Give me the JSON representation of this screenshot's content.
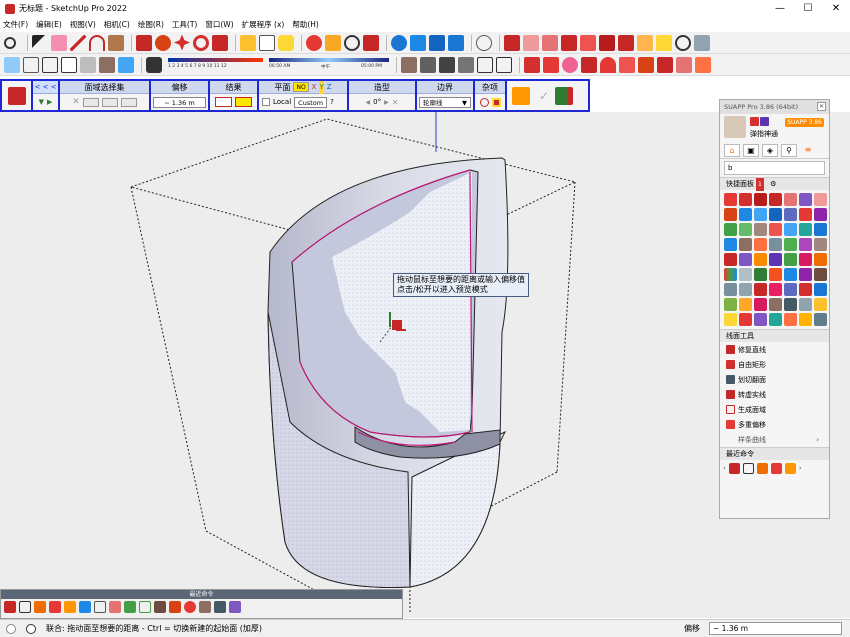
{
  "window": {
    "title": "无标题 - SketchUp Pro 2022",
    "min": "—",
    "max": "☐",
    "close": "✕"
  },
  "menu": [
    "文件(F)",
    "编辑(E)",
    "视图(V)",
    "相机(C)",
    "绘图(R)",
    "工具(T)",
    "窗口(W)",
    "扩展程序 (x)",
    "帮助(H)"
  ],
  "shadow": {
    "months": "1 2 3 4 5 6 7 8 9 10 11 12",
    "time_start": "06:50 AM",
    "time_mid": "中午",
    "time_end": "05:00 PM"
  },
  "suapp_bar": {
    "nav": {
      "label": "< < <"
    },
    "face_select": {
      "label": "面域选择集"
    },
    "offset": {
      "label": "偏移",
      "value": "~ 1.36 m"
    },
    "result": {
      "label": "结果"
    },
    "plane": {
      "label": "平面",
      "no": "NO",
      "x": "X",
      "y": "Y",
      "z": "Z",
      "local": "Local",
      "custom": "Custom",
      "q": "?"
    },
    "shape": {
      "label": "造型",
      "value": "0°"
    },
    "edge": {
      "label": "边界",
      "value": "轮廓线"
    },
    "misc": {
      "label": "杂项"
    }
  },
  "tooltip": {
    "line1": "拖动鼠标至想要的距离或输入偏移值",
    "line2": "点击/松开以进入预览模式"
  },
  "suapp_panel": {
    "title": "SUAPP Pro 3.86 (64bit)",
    "username": "弹指神通",
    "version_badge": "SUAPP 3.86",
    "search_value": "b",
    "quick_panel": {
      "label": "快捷面板",
      "count": "1"
    },
    "line_tools": {
      "label": "线面工具",
      "items": [
        "修复直线",
        "自由矩形",
        "划切翻面",
        "转虚实线",
        "生成面域",
        "多重偏移"
      ]
    },
    "spline_label": "样条曲线",
    "recent_label": "最近命令"
  },
  "bottom_recent": {
    "title": "最近命令"
  },
  "statusbar": {
    "message": "联合: 拖动面至想要的距离 - Ctrl = 切换新建的起始面 (加厚)",
    "vcb_label": "偏移",
    "vcb_value": "~ 1.36 m"
  },
  "colors": {
    "accent": "#1e27d6",
    "viewport_bg": "#ededed",
    "bottom_header": "#5b6677"
  }
}
